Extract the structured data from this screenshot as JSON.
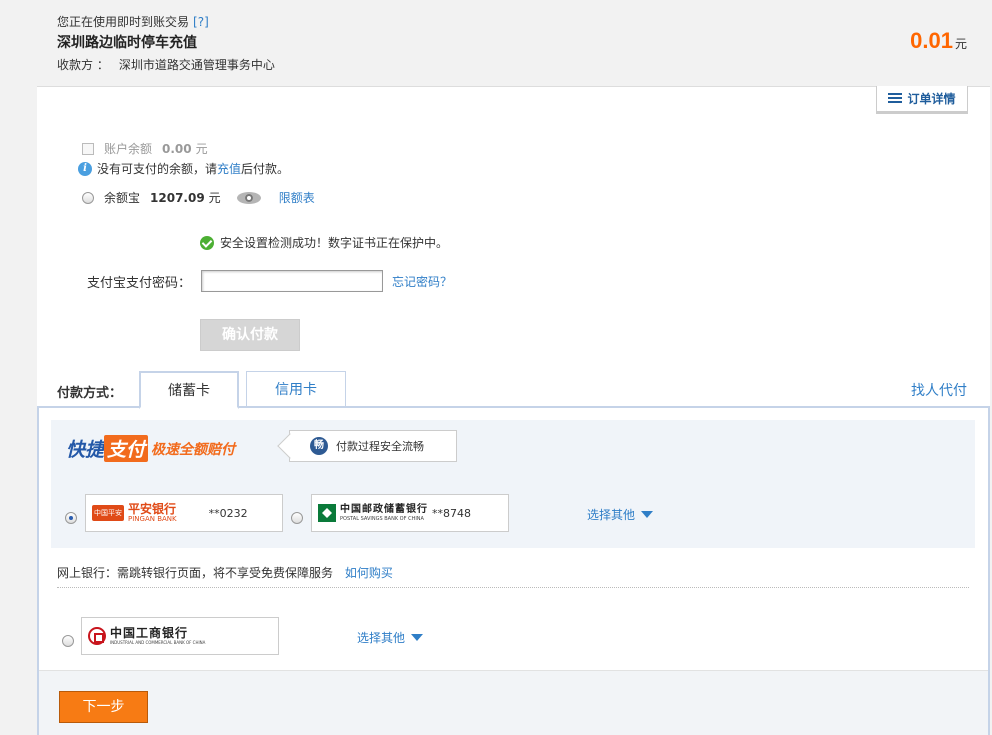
{
  "header": {
    "notice": "您正在使用即时到账交易",
    "help": "[?]",
    "title": "深圳路边临时停车充值",
    "payee_label": "收款方 ：",
    "payee": "深圳市道路交通管理事务中心",
    "amount": "0.01",
    "amount_unit": "元"
  },
  "order_detail": {
    "label": "订单详情",
    "icon": "list-icon"
  },
  "balance": {
    "label": "账户余额",
    "value": "0.00",
    "unit": "元",
    "info_prefix": "没有可支付的余额，请",
    "info_link": "充值",
    "info_suffix": "后付款。"
  },
  "yuebao": {
    "label": "余额宝",
    "value": "1207.09",
    "unit": "元",
    "limit_link": "限额表"
  },
  "security": {
    "message": "安全设置检测成功！数字证书正在保护中。"
  },
  "password": {
    "label": "支付宝支付密码：",
    "value": "",
    "forgot": "忘记密码？"
  },
  "confirm_button": "确认付款",
  "payment": {
    "label": "付款方式：",
    "tabs": [
      "储蓄卡",
      "信用卡"
    ],
    "active_tab": "储蓄卡",
    "find_payer": "找人代付"
  },
  "quickpay": {
    "logo_a": "快捷",
    "logo_b": "支付",
    "logo_c": "极速全额赔付",
    "safe_badge_icon": "畅",
    "safe_badge": "付款过程安全流畅",
    "banks": [
      {
        "mark": "中国平安",
        "name": "平安银行",
        "en": "PINGAN BANK",
        "account": "**0232",
        "selected": true
      },
      {
        "name": "中国邮政储蓄银行",
        "en": "POSTAL SAVINGS BANK OF CHINA",
        "account": "**8748",
        "selected": false
      }
    ],
    "choose_other": "选择其他"
  },
  "netbank": {
    "text": "网上银行：需跳转银行页面，将不享受免费保障服务",
    "link": "如何购买",
    "bank": {
      "name": "中国工商银行",
      "en": "INDUSTRIAL AND COMMERCIAL BANK OF CHINA"
    },
    "choose_other": "选择其他"
  },
  "next_button": "下一步",
  "colors": {
    "accent": "#ff6600",
    "link": "#2f7ec7",
    "next_button": "#f77b14"
  }
}
